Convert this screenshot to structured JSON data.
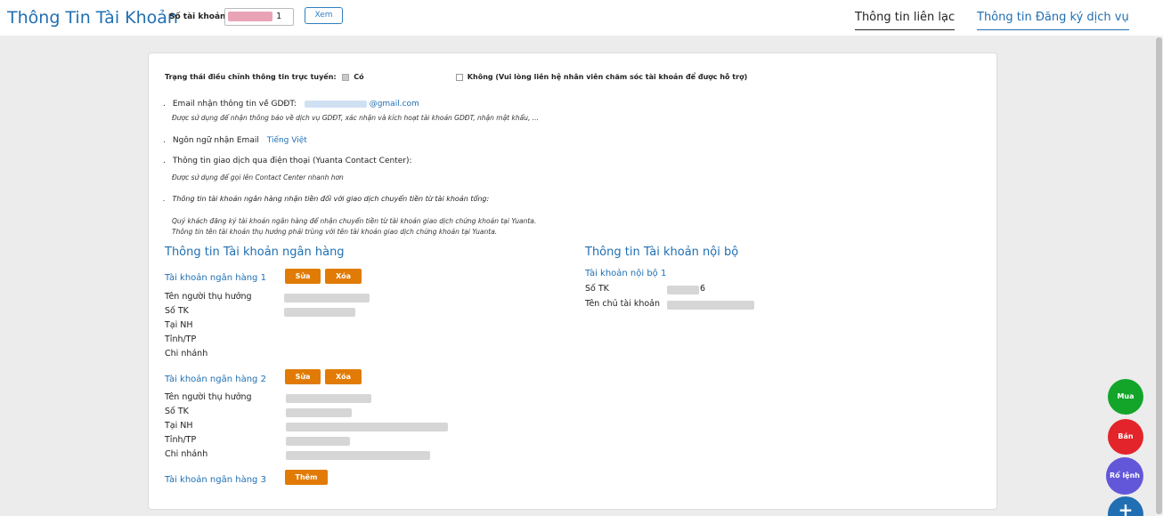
{
  "header": {
    "title": "Thông Tin Tài Khoản",
    "account_label": "Số tài khoản",
    "account_value": "1",
    "view_button": "Xem",
    "tabs": [
      "Thông tin liên lạc",
      "Thông tin Đăng ký dịch vụ"
    ]
  },
  "status": {
    "label": "Trạng thái điều chỉnh thông tin trực tuyến:",
    "yes": "Có",
    "no": "Không (Vui lòng liên hệ nhân viên chăm sóc tài khoản để được hỗ trợ)"
  },
  "email": {
    "label": "Email nhận thông tin về GDĐT:",
    "value": "@gmail.com",
    "note": "Được sử dụng để nhận thông báo về dịch vụ GDĐT, xác nhận và kích hoạt tài khoản GDĐT, nhận mật khẩu, ..."
  },
  "language": {
    "label": "Ngôn ngữ nhận Email",
    "value": "Tiếng Việt"
  },
  "phone": {
    "label": "Thông tin giao dịch qua điện thoại (Yuanta Contact Center):",
    "note": "Được sử dụng để gọi lên Contact Center nhanh hơn"
  },
  "bank_info": {
    "label": "Thông tin tài khoản ngân hàng nhận tiền đối với giao dịch chuyển tiền từ tài khoản tổng:",
    "note1": "Quý khách đăng ký tài khoản ngân hàng để nhận chuyển tiền từ tài khoản giao dịch chứng khoán tại Yuanta.",
    "note2": "Thông tin tên tài khoản thụ hưởng phải trùng với tên tài khoản giao dịch chứng khoán tại Yuanta."
  },
  "bank_section": {
    "title": "Thông tin Tài khoản ngân hàng",
    "edit": "Sửa",
    "delete": "Xóa",
    "add": "Thêm",
    "accounts": [
      {
        "title": "Tài khoản ngân hàng 1"
      },
      {
        "title": "Tài khoản ngân hàng 2"
      },
      {
        "title": "Tài khoản ngân hàng 3"
      }
    ],
    "fields": [
      "Tên người thụ hưởng",
      "Số TK",
      "Tại NH",
      "Tỉnh/TP",
      "Chi nhánh"
    ]
  },
  "internal_section": {
    "title": "Thông tin Tài khoản nội bộ",
    "account_title": "Tài khoản nội bộ 1",
    "account_no_label": "Số TK",
    "account_no_value": "6",
    "owner_label": "Tên chủ tài khoản"
  },
  "fabs": {
    "buy": "Mua",
    "sell": "Bán",
    "orders": "Rổ lệnh",
    "plus": "+"
  },
  "colors": {
    "brand_blue": "#1f6fb2",
    "orange": "#e17b05",
    "buy_green": "#12a52a",
    "sell_red": "#e3242b",
    "orders_purple": "#6257d9"
  }
}
